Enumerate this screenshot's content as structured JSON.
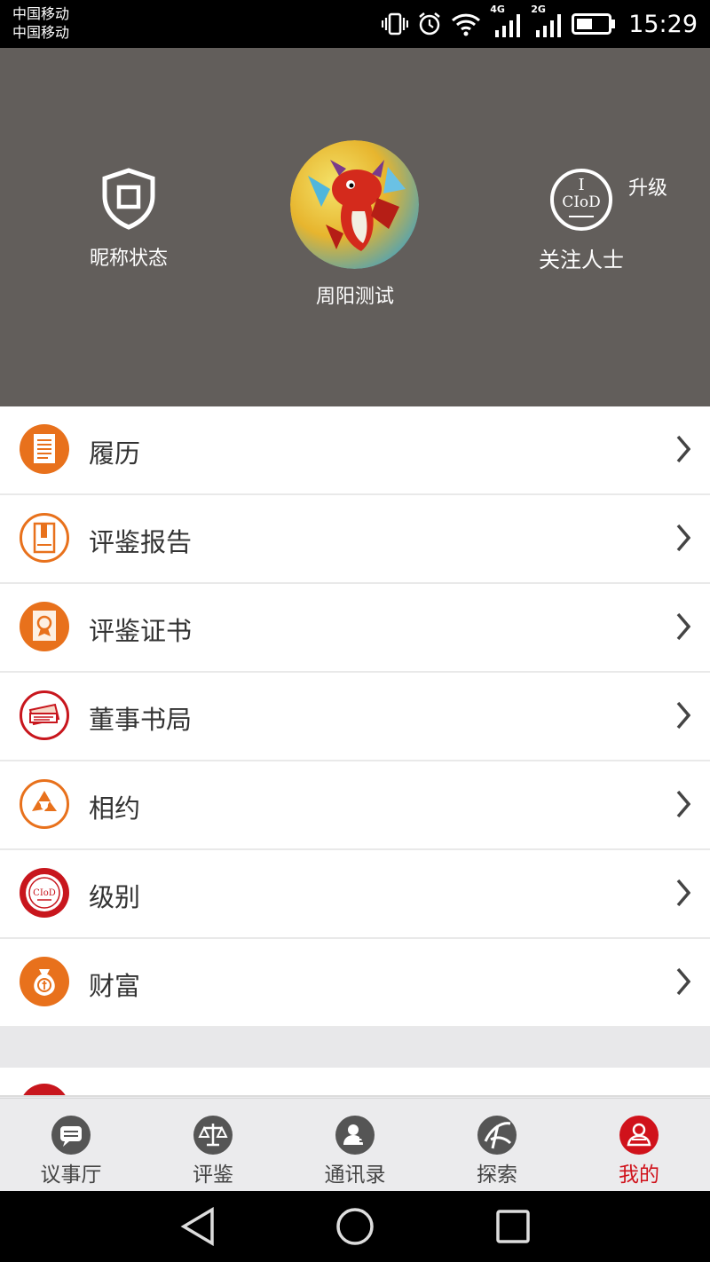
{
  "status_bar": {
    "carrier_1": "中国移动",
    "carrier_2": "中国移动",
    "net_1": "4G",
    "net_2": "2G",
    "time": "15:29"
  },
  "profile": {
    "nickname_status_label": "昵称状态",
    "username": "周阳测试",
    "follow_label": "关注人士",
    "upgrade_label": "升级",
    "badge_text": "CIoD"
  },
  "menu": [
    {
      "label": "履历",
      "icon": "resume-icon"
    },
    {
      "label": "评鉴报告",
      "icon": "report-icon"
    },
    {
      "label": "评鉴证书",
      "icon": "certificate-icon"
    },
    {
      "label": "董事书局",
      "icon": "bookstore-icon"
    },
    {
      "label": "相约",
      "icon": "appointment-icon"
    },
    {
      "label": "级别",
      "icon": "level-icon"
    },
    {
      "label": "财富",
      "icon": "money-bag-icon"
    }
  ],
  "tabs": [
    {
      "label": "议事厅",
      "icon": "chat-bubble-icon"
    },
    {
      "label": "评鉴",
      "icon": "scale-icon"
    },
    {
      "label": "通讯录",
      "icon": "contacts-icon"
    },
    {
      "label": "探索",
      "icon": "explore-icon"
    },
    {
      "label": "我的",
      "icon": "profile-icon",
      "active": true
    }
  ],
  "colors": {
    "header_bg": "#625e5b",
    "accent_orange": "#e8711c",
    "accent_red": "#c8161d",
    "tab_active": "#d0121b"
  }
}
